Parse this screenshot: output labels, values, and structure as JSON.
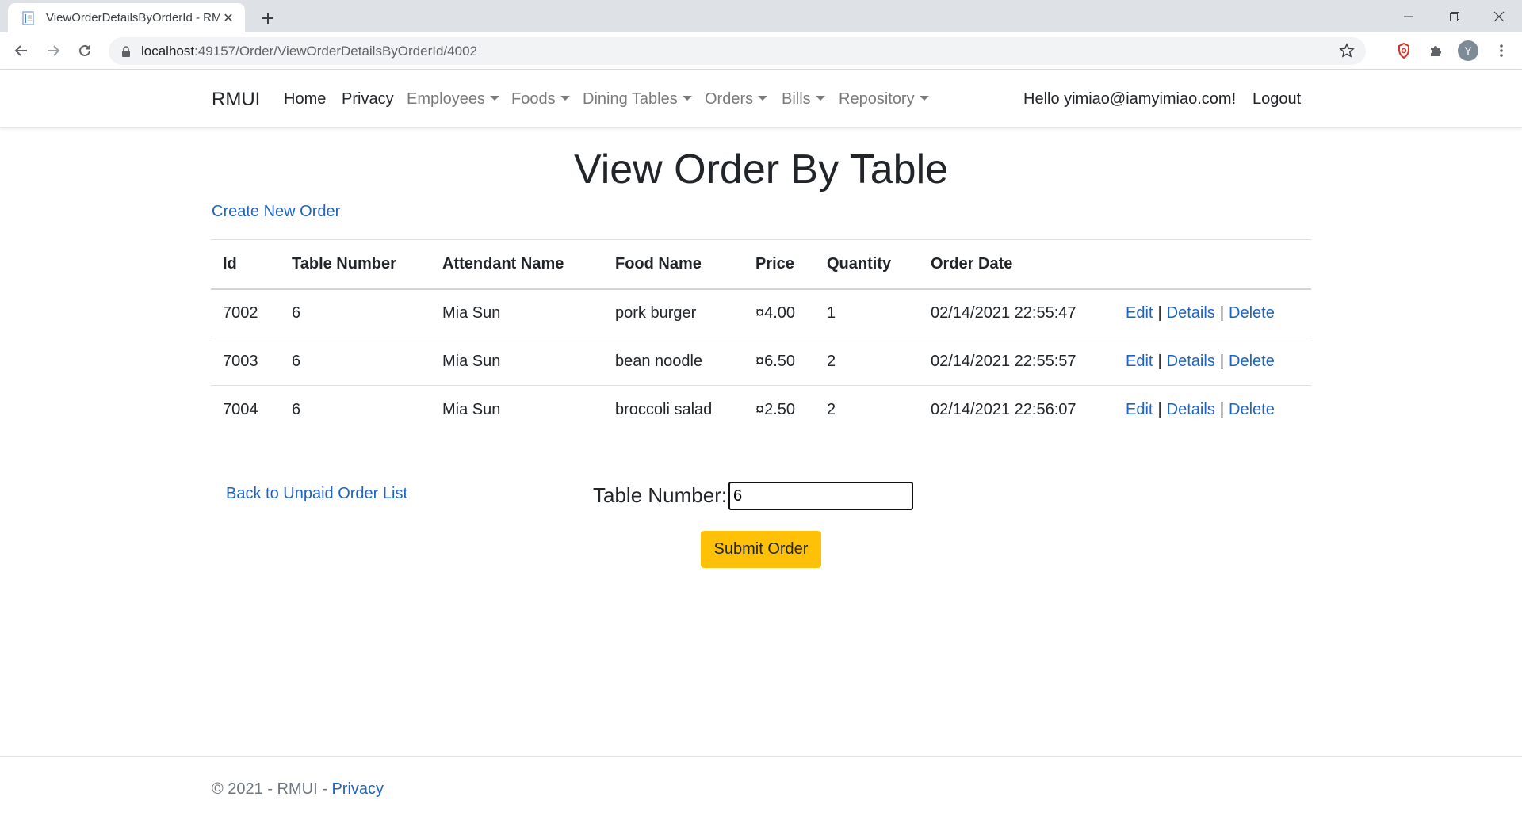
{
  "browser": {
    "tab_title": "ViewOrderDetailsByOrderId - RMUI",
    "url_host": "localhost",
    "url_path": ":49157/Order/ViewOrderDetailsByOrderId/4002",
    "profile_initial": "Y"
  },
  "navbar": {
    "brand": "RMUI",
    "links": [
      {
        "label": "Home"
      },
      {
        "label": "Privacy"
      }
    ],
    "dropdowns": [
      {
        "label": "Employees"
      },
      {
        "label": "Foods"
      },
      {
        "label": "Dining Tables"
      },
      {
        "label": "Orders"
      },
      {
        "label": "Bills"
      },
      {
        "label": "Repository"
      }
    ],
    "greeting": "Hello yimiao@iamyimiao.com!",
    "logout": "Logout"
  },
  "page": {
    "title": "View Order By Table",
    "create_link": "Create New Order"
  },
  "table": {
    "headers": [
      "Id",
      "Table Number",
      "Attendant Name",
      "Food Name",
      "Price",
      "Quantity",
      "Order Date"
    ],
    "rows": [
      {
        "id": "7002",
        "table_number": "6",
        "attendant": "Mia Sun",
        "food": "pork burger",
        "price": "¤4.00",
        "quantity": "1",
        "date": "02/14/2021 22:55:47"
      },
      {
        "id": "7003",
        "table_number": "6",
        "attendant": "Mia Sun",
        "food": "bean noodle",
        "price": "¤6.50",
        "quantity": "2",
        "date": "02/14/2021 22:55:57"
      },
      {
        "id": "7004",
        "table_number": "6",
        "attendant": "Mia Sun",
        "food": "broccoli salad",
        "price": "¤2.50",
        "quantity": "2",
        "date": "02/14/2021 22:56:07"
      }
    ],
    "actions": {
      "edit": "Edit",
      "details": "Details",
      "delete": "Delete",
      "separator": "|"
    }
  },
  "form": {
    "back_link": "Back to Unpaid Order List",
    "table_number_label": "Table Number:",
    "table_number_value": "6",
    "submit_label": "Submit Order"
  },
  "footer": {
    "text": "© 2021 - RMUI - ",
    "privacy": "Privacy"
  },
  "colors": {
    "link": "#1e63c4",
    "submit": "#ffc107"
  }
}
